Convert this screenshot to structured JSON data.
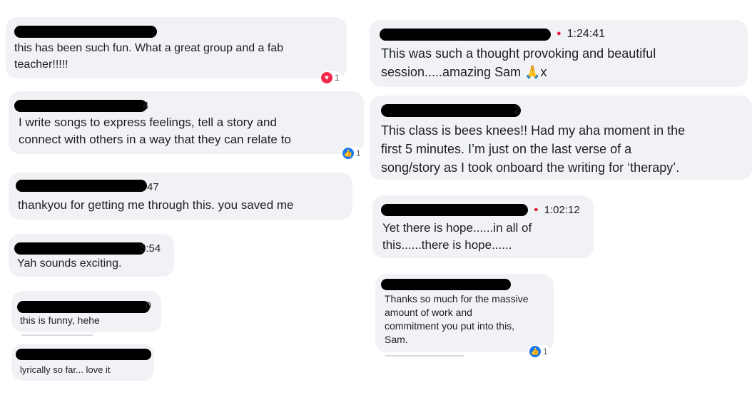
{
  "left": [
    {
      "meta_tail": "",
      "text": "this has been such fun. What a great group and a fab\nteacher!!!!!",
      "reaction": {
        "icon": "heart-icon",
        "count": "1"
      }
    },
    {
      "meta_tail": "4",
      "text": "I write songs to express feelings, tell a story and\nconnect with others in a way that they can relate to",
      "reaction": {
        "icon": "thumbs-up-icon",
        "count": "1"
      }
    },
    {
      "meta_tail": "47",
      "text": "thankyou for getting me through this. you saved me"
    },
    {
      "meta_tail": "5:54",
      "text": "Yah sounds exciting."
    },
    {
      "meta_tail": "0",
      "text": "this is funny, hehe"
    },
    {
      "meta_tail": "",
      "text": "lyrically so far... love it"
    }
  ],
  "right": [
    {
      "timestamp": "1:24:41",
      "text": "This was such a thought provoking and beautiful\nsession.....amazing Sam 🙏x"
    },
    {
      "meta_tail": "2",
      "text": "This class is bees knees!! Had my aha moment in the\nfirst 5 minutes. I’m just on the last verse of a\nsong/story as I took onboard the writing for ‘therapy’."
    },
    {
      "timestamp": "1:02:12",
      "text": "Yet there is hope......in all of\nthis......there is hope......"
    },
    {
      "text": "Thanks so much for the massive\namount of work and\ncommitment you put into this,\nSam.",
      "reaction": {
        "icon": "thumbs-up-icon",
        "count": "1"
      }
    }
  ],
  "colors": {
    "bubble": "#f0f2f5",
    "redaction": "#000000",
    "timestamp_dot": "#e41e3f",
    "like": "#1877f2",
    "love": "#f0284a"
  }
}
